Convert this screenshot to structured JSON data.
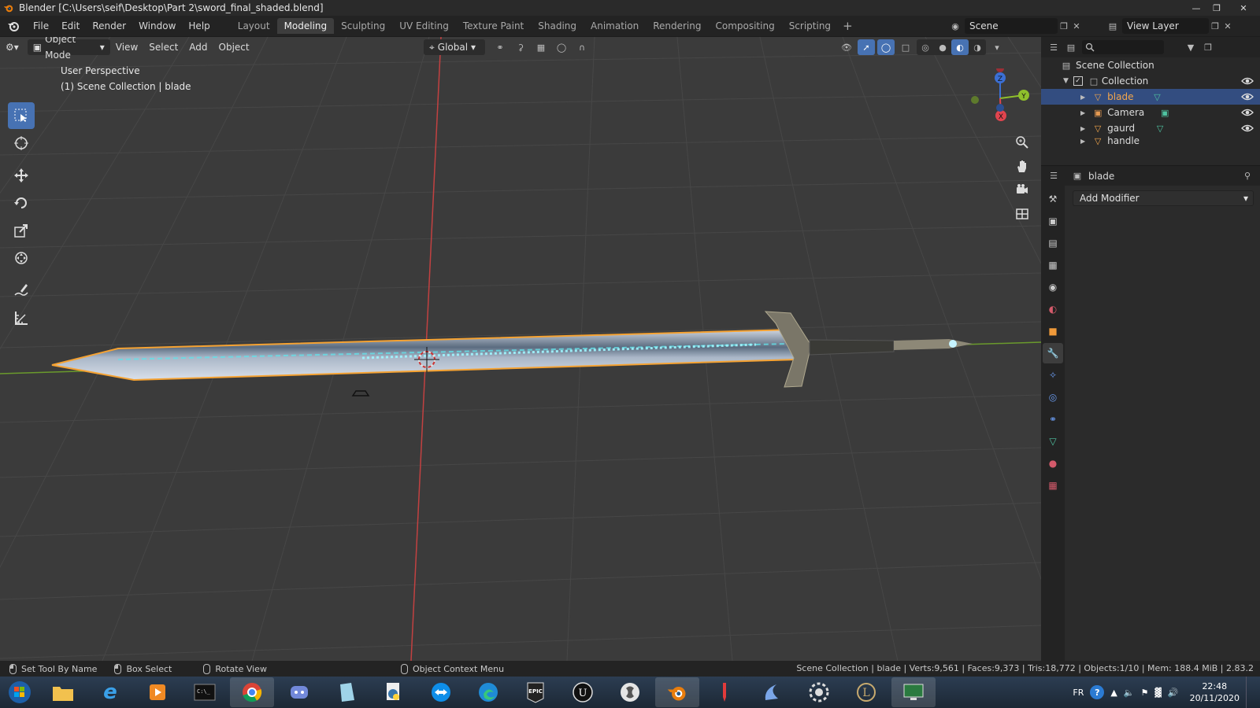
{
  "window": {
    "title": "Blender [C:\\Users\\seif\\Desktop\\Part 2\\sword_final_shaded.blend]"
  },
  "menu": [
    "File",
    "Edit",
    "Render",
    "Window",
    "Help"
  ],
  "workspaces": [
    "Layout",
    "Modeling",
    "Sculpting",
    "UV Editing",
    "Texture Paint",
    "Shading",
    "Animation",
    "Rendering",
    "Compositing",
    "Scripting"
  ],
  "active_workspace": "Modeling",
  "scene": {
    "name": "Scene"
  },
  "view_layer": {
    "name": "View Layer"
  },
  "viewport": {
    "mode": "Object Mode",
    "menus": [
      "View",
      "Select",
      "Add",
      "Object"
    ],
    "orientation": "Global",
    "info_line1": "User Perspective",
    "info_line2": "(1) Scene Collection | blade",
    "colors": {
      "background": "#3b3b3b",
      "grid": "#474747",
      "x_axis": "#c24141",
      "y_axis": "#6a9a2c",
      "selection": "#f5a232"
    }
  },
  "gizmo": {
    "x": "X",
    "y": "Y",
    "z": "Z"
  },
  "outliner": {
    "root": "Scene Collection",
    "collection": "Collection",
    "objects": [
      "blade",
      "Camera",
      "gaurd",
      "handle"
    ],
    "selected": "blade"
  },
  "properties": {
    "object_name": "blade",
    "add_modifier": "Add Modifier"
  },
  "statusbar": {
    "hint1": "Set Tool By Name",
    "hint2": "Box Select",
    "hint3": "Rotate View",
    "hint4": "Object Context Menu",
    "stats": "Scene Collection | blade | Verts:9,561 | Faces:9,373 | Tris:18,772 | Objects:1/10 | Mem: 188.4 MiB | 2.83.2"
  },
  "taskbar": {
    "apps": [
      "file-explorer",
      "internet-explorer",
      "media-player",
      "cmd",
      "chrome",
      "discord",
      "notepad",
      "python",
      "teamviewer",
      "edge",
      "epic-games",
      "unreal",
      "steam",
      "blender",
      "pencil",
      "krita",
      "settings",
      "league",
      "excel"
    ],
    "lang": "FR",
    "time": "22:48",
    "date": "20/11/2020"
  }
}
